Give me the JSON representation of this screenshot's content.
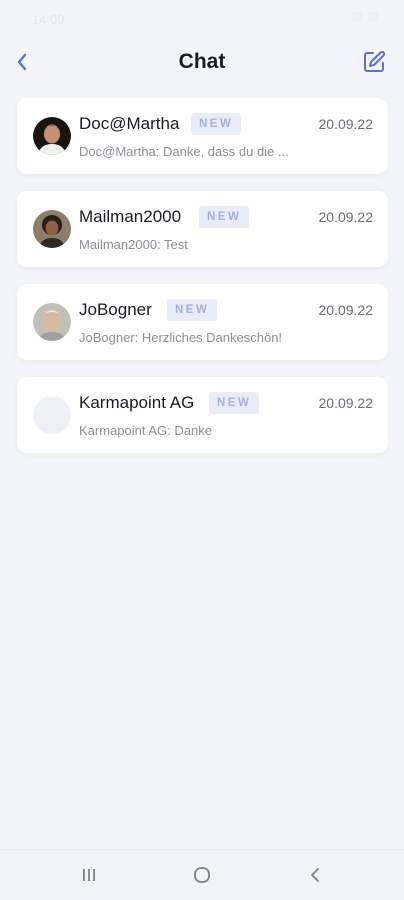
{
  "status": {
    "time": "14:09"
  },
  "header": {
    "title": "Chat",
    "back_icon": "chevron-left-icon",
    "compose_icon": "edit-icon",
    "accent": "#5b6fd8"
  },
  "chats": [
    {
      "name": "Doc@Martha",
      "badge": "NEW",
      "date": "20.09.22",
      "preview": "Doc@Martha: Danke, dass du die ..."
    },
    {
      "name": "Mailman2000",
      "badge": "NEW",
      "date": "20.09.22",
      "preview": "Mailman2000: Test"
    },
    {
      "name": "JoBogner",
      "badge": "NEW",
      "date": "20.09.22",
      "preview": "JoBogner: Herzliches Dankeschön!"
    },
    {
      "name": "Karmapoint AG",
      "badge": "NEW",
      "date": "20.09.22",
      "preview": "Karmapoint AG: Danke"
    }
  ],
  "nav": {
    "recents_icon": "recents-icon",
    "home_icon": "home-icon",
    "back_icon": "back-icon"
  }
}
